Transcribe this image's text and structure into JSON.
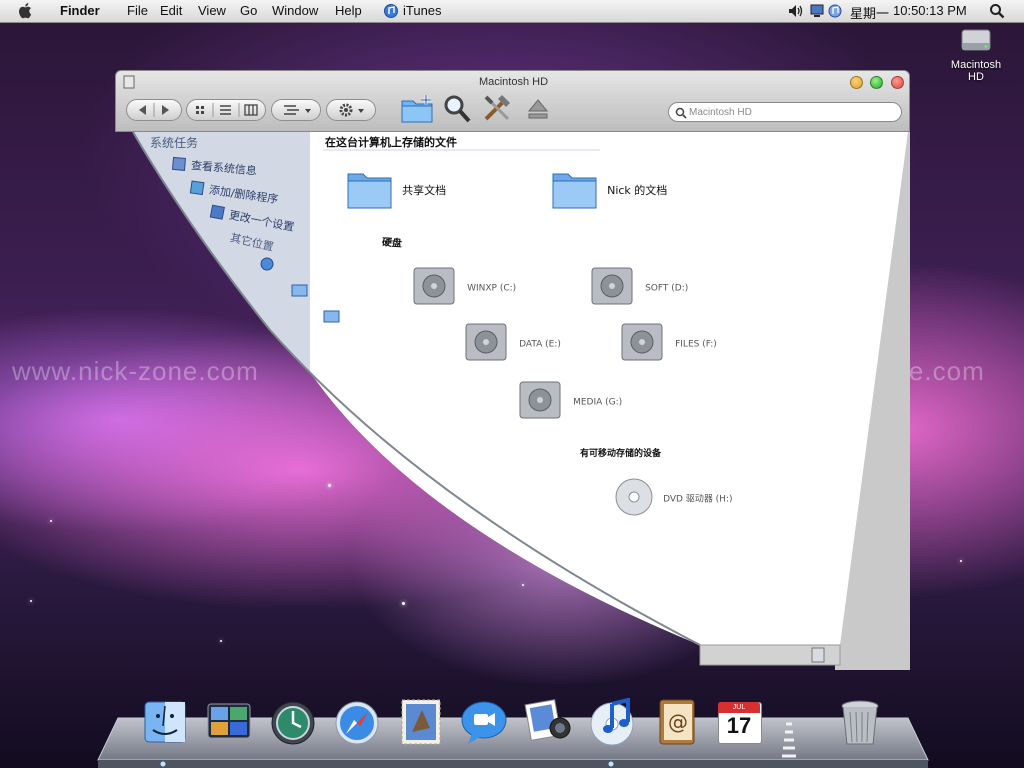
{
  "menubar": {
    "app_name": "Finder",
    "menus": [
      "File",
      "Edit",
      "View",
      "Go",
      "Window",
      "Help"
    ],
    "itunes_label": "iTunes",
    "day": "星期一",
    "time": "10:50:13 PM"
  },
  "desktop": {
    "hd_label": "Macintosh HD",
    "watermark": "www.nick-zone.com"
  },
  "window": {
    "title": "Macintosh HD",
    "search_placeholder": "Macintosh HD"
  },
  "sidebar": {
    "system_tasks_header": "系统任务",
    "system_tasks": [
      "查看系统信息",
      "添加/删除程序",
      "更改一个设置"
    ],
    "other_places_header": "其它位置"
  },
  "content": {
    "files_header": "在这台计算机上存储的文件",
    "folders": [
      "共享文档",
      "Nick 的文档"
    ],
    "drives_header": "硬盘",
    "drives": [
      "WINXP (C:)",
      "SOFT (D:)",
      "DATA (E:)",
      "FILES (F:)",
      "MEDIA (G:)"
    ],
    "removable_header": "有可移动存储的设备",
    "optical": "DVD 驱动器 (H:)"
  },
  "dock": {
    "calendar_month": "JUL",
    "calendar_day": "17",
    "apps": [
      "finder",
      "dashboard",
      "time-machine",
      "safari",
      "mail",
      "ichat",
      "iphoto",
      "itunes",
      "address-book",
      "ical",
      "separator",
      "trash"
    ]
  },
  "colors": {
    "menubar": "#e6e6e6",
    "sidebar": "#d4dbe6",
    "window_chrome": "#c8c8c8",
    "traffic_red": "#e0443e",
    "traffic_yellow": "#dea123",
    "traffic_green": "#1aab29"
  }
}
